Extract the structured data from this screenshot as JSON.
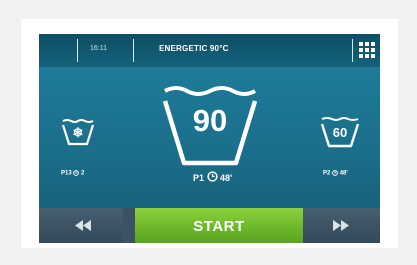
{
  "header": {
    "time": "16:11",
    "title": "ENERGETIC 90°C",
    "menu_icon": "grid-menu-icon"
  },
  "programs": {
    "left": {
      "symbol": "❄",
      "icon": "snowflake-icon",
      "label": "P13",
      "duration": "2"
    },
    "center": {
      "value": "90",
      "label": "P1",
      "duration": "48'"
    },
    "right": {
      "value": "60",
      "label": "P2",
      "duration": "48'"
    }
  },
  "controls": {
    "prev_icon": "rewind-icon",
    "start_label": "START",
    "next_icon": "fast-forward-icon"
  },
  "colors": {
    "screen": "#1b6f8b",
    "topbar": "#0f4e63",
    "start": "#6eb82b",
    "nav": "#3a5262"
  }
}
